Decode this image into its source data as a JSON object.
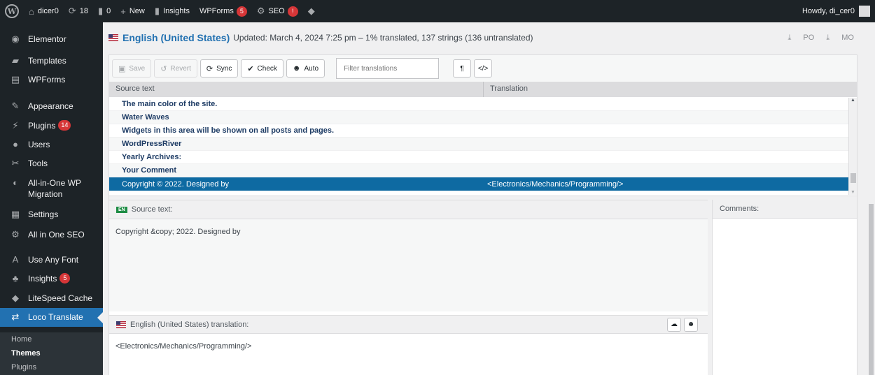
{
  "adminbar": {
    "site_name": "dicer0",
    "updates_count": "18",
    "comments_count": "0",
    "new_label": "New",
    "insights_label": "Insights",
    "wpforms_label": "WPForms",
    "wpforms_badge": "5",
    "seo_label": "SEO",
    "seo_badge": "!",
    "howdy": "Howdy, di_cer0"
  },
  "sidebar": {
    "items": [
      {
        "label": "Elementor",
        "icon": "elementor-icon"
      },
      {
        "label": "Templates",
        "icon": "folder-icon"
      },
      {
        "label": "WPForms",
        "icon": "form-icon"
      },
      {
        "label": "Appearance",
        "icon": "paintbrush-icon"
      },
      {
        "label": "Plugins",
        "icon": "plugin-icon",
        "badge": "14"
      },
      {
        "label": "Users",
        "icon": "users-icon"
      },
      {
        "label": "Tools",
        "icon": "wrench-icon"
      },
      {
        "label": "All-in-One WP Migration",
        "icon": "migration-icon"
      },
      {
        "label": "Settings",
        "icon": "settings-icon"
      },
      {
        "label": "All in One SEO",
        "icon": "seo-icon"
      },
      {
        "label": "Use Any Font",
        "icon": "font-icon"
      },
      {
        "label": "Insights",
        "icon": "insights-icon",
        "badge": "5"
      },
      {
        "label": "LiteSpeed Cache",
        "icon": "litespeed-icon"
      },
      {
        "label": "Loco Translate",
        "icon": "translate-icon"
      }
    ],
    "submenu": [
      "Home",
      "Themes",
      "Plugins"
    ]
  },
  "header": {
    "locale": "English (United States)",
    "status": "Updated: March 4, 2024 7:25 pm – 1% translated, 137 strings (136 untranslated)",
    "download_po": "PO",
    "download_mo": "MO"
  },
  "toolbar": {
    "save": "Save",
    "revert": "Revert",
    "sync": "Sync",
    "check": "Check",
    "auto": "Auto",
    "filter_placeholder": "Filter translations",
    "pilcrow": "¶",
    "code": "</>"
  },
  "list": {
    "col_source": "Source text",
    "col_translation": "Translation",
    "rows": [
      {
        "source": "The main color of the site.",
        "translation": ""
      },
      {
        "source": "Water Waves",
        "translation": ""
      },
      {
        "source": "Widgets in this area will be shown on all posts and pages.",
        "translation": ""
      },
      {
        "source": "WordPressRiver",
        "translation": ""
      },
      {
        "source": "Yearly Archives:",
        "translation": ""
      },
      {
        "source": "Your Comment",
        "translation": ""
      },
      {
        "source": "Copyright © 2022. Designed by",
        "translation": "<Electronics/Mechanics/Programming/>"
      }
    ]
  },
  "source_pane": {
    "lang_badge": "EN",
    "title": "Source text:",
    "text": "Copyright &copy;  2022. Designed by"
  },
  "target_pane": {
    "title": "English (United States) translation:",
    "text": "<Electronics/Mechanics/Programming/>"
  },
  "comments_pane": {
    "title": "Comments:"
  },
  "colors": {
    "sidebar_bg": "#1d2327",
    "accent": "#2271b1",
    "selected_row": "#0e6aa2",
    "badge": "#d63638"
  }
}
